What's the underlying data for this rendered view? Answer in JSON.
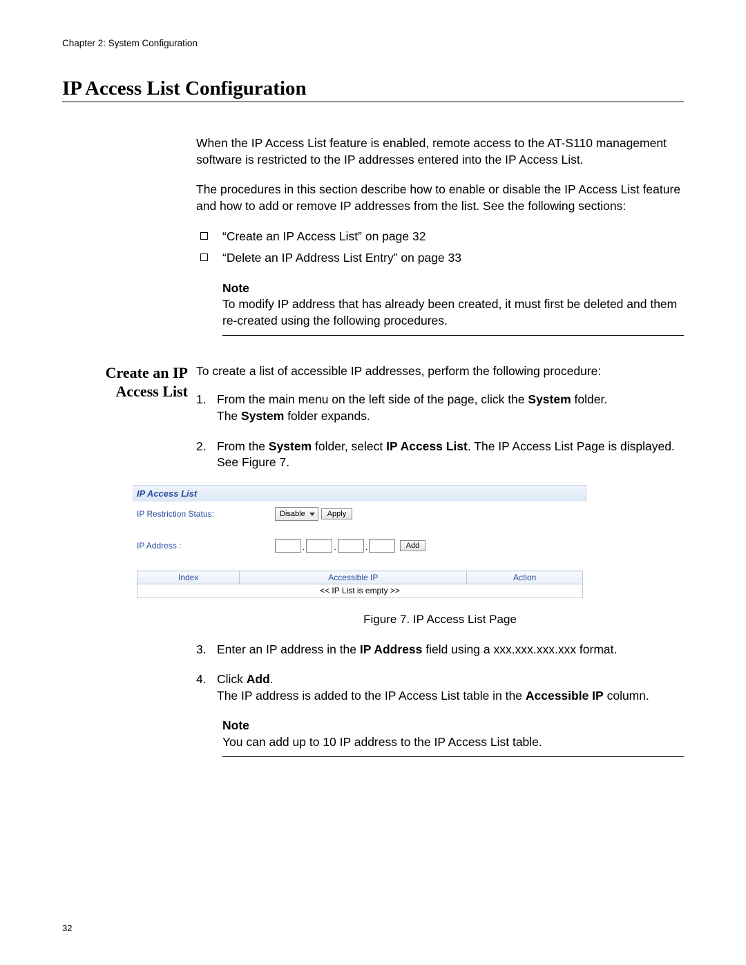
{
  "header": {
    "chapter": "Chapter 2: System Configuration"
  },
  "title": "IP Access List Configuration",
  "intro_p1": "When the IP Access List feature is enabled, remote access to the AT-S110 management software is restricted to the IP addresses entered into the IP Access List.",
  "intro_p2": "The procedures in this section describe how to enable or disable the IP Access List feature and how to add or remove IP addresses from the list. See the following sections:",
  "bullets": [
    "“Create an IP Access List” on page 32",
    "“Delete an IP Address List Entry” on page 33"
  ],
  "note1": {
    "label": "Note",
    "text": "To modify IP address that has already been created, it must first be deleted and them re-created using the following procedures."
  },
  "subsection_heading": "Create an IP Access List",
  "sub_intro": "To create a list of accessible IP addresses, perform the following procedure:",
  "step1_num": "1.",
  "step1_a": "From the main menu on the left side of the page, click the ",
  "step1_bold_a": "System",
  "step1_b": " folder.",
  "step1_line2_a": "The ",
  "step1_line2_bold": "System",
  "step1_line2_b": " folder expands.",
  "step2_num": "2.",
  "step2_a": "From the ",
  "step2_bold_a": "System",
  "step2_b": " folder, select ",
  "step2_bold_b": "IP Access List",
  "step2_c": ". The IP Access List Page is displayed. See Figure 7.",
  "figure": {
    "panel_title": "IP Access List",
    "row1_label": "IP Restriction Status:",
    "select_value": "Disable",
    "apply_label": "Apply",
    "row2_label": "IP Address :",
    "add_label": "Add",
    "col_index": "Index",
    "col_accip": "Accessible IP",
    "col_action": "Action",
    "empty_row": "<< IP List is empty >>",
    "caption": "Figure 7. IP Access List Page"
  },
  "step3_num": "3.",
  "step3_a": "Enter an IP address in the ",
  "step3_bold": "IP Address",
  "step3_b": " field using a xxx.xxx.xxx.xxx format.",
  "step4_num": "4.",
  "step4_a": "Click ",
  "step4_bold_a": "Add",
  "step4_b": ".",
  "step4_line2_a": "The IP address is added to the IP Access List table in the ",
  "step4_line2_bold": "Accessible IP",
  "step4_line2_b": " column.",
  "note2": {
    "label": "Note",
    "text": "You can add up to 10 IP address to the IP Access List table."
  },
  "page_number": "32"
}
